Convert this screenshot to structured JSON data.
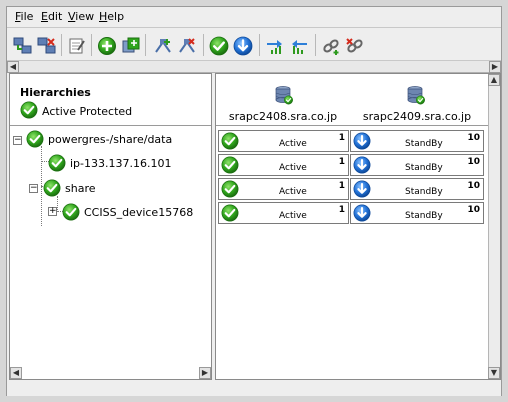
{
  "menu": [
    {
      "pre": "",
      "u": "F",
      "post": "ile"
    },
    {
      "pre": "",
      "u": "E",
      "post": "dit"
    },
    {
      "pre": "",
      "u": "V",
      "post": "iew"
    },
    {
      "pre": "",
      "u": "H",
      "post": "elp"
    }
  ],
  "toolbar_icons": [
    "connect-server-icon",
    "disconnect-server-icon",
    "properties-icon",
    "create-resource-icon",
    "extend-resource-icon",
    "add-comm-path-icon",
    "remove-comm-path-icon",
    "in-service-icon",
    "out-of-service-icon",
    "upgrade-priority-icon",
    "downgrade-priority-icon",
    "create-dependency-icon",
    "delete-dependency-icon"
  ],
  "hierarchies": {
    "title": "Hierarchies",
    "status": "Active Protected"
  },
  "tree": [
    {
      "label": "powergres-/share/data",
      "state": "active"
    },
    {
      "label": "ip-133.137.16.101",
      "state": "active"
    },
    {
      "label": "share",
      "state": "active"
    },
    {
      "label": "CCISS_device15768",
      "state": "active"
    }
  ],
  "servers": [
    {
      "name": "srapc2408.sra.co.jp"
    },
    {
      "name": "srapc2409.sra.co.jp"
    }
  ],
  "grid": [
    [
      {
        "state": "Active",
        "priority": "1"
      },
      {
        "state": "StandBy",
        "priority": "10"
      }
    ],
    [
      {
        "state": "Active",
        "priority": "1"
      },
      {
        "state": "StandBy",
        "priority": "10"
      }
    ],
    [
      {
        "state": "Active",
        "priority": "1"
      },
      {
        "state": "StandBy",
        "priority": "10"
      }
    ],
    [
      {
        "state": "Active",
        "priority": "1"
      },
      {
        "state": "StandBy",
        "priority": "10"
      }
    ]
  ],
  "colors": {
    "active_green": "#2e9a1e",
    "standby_blue": "#1f6fd1"
  }
}
